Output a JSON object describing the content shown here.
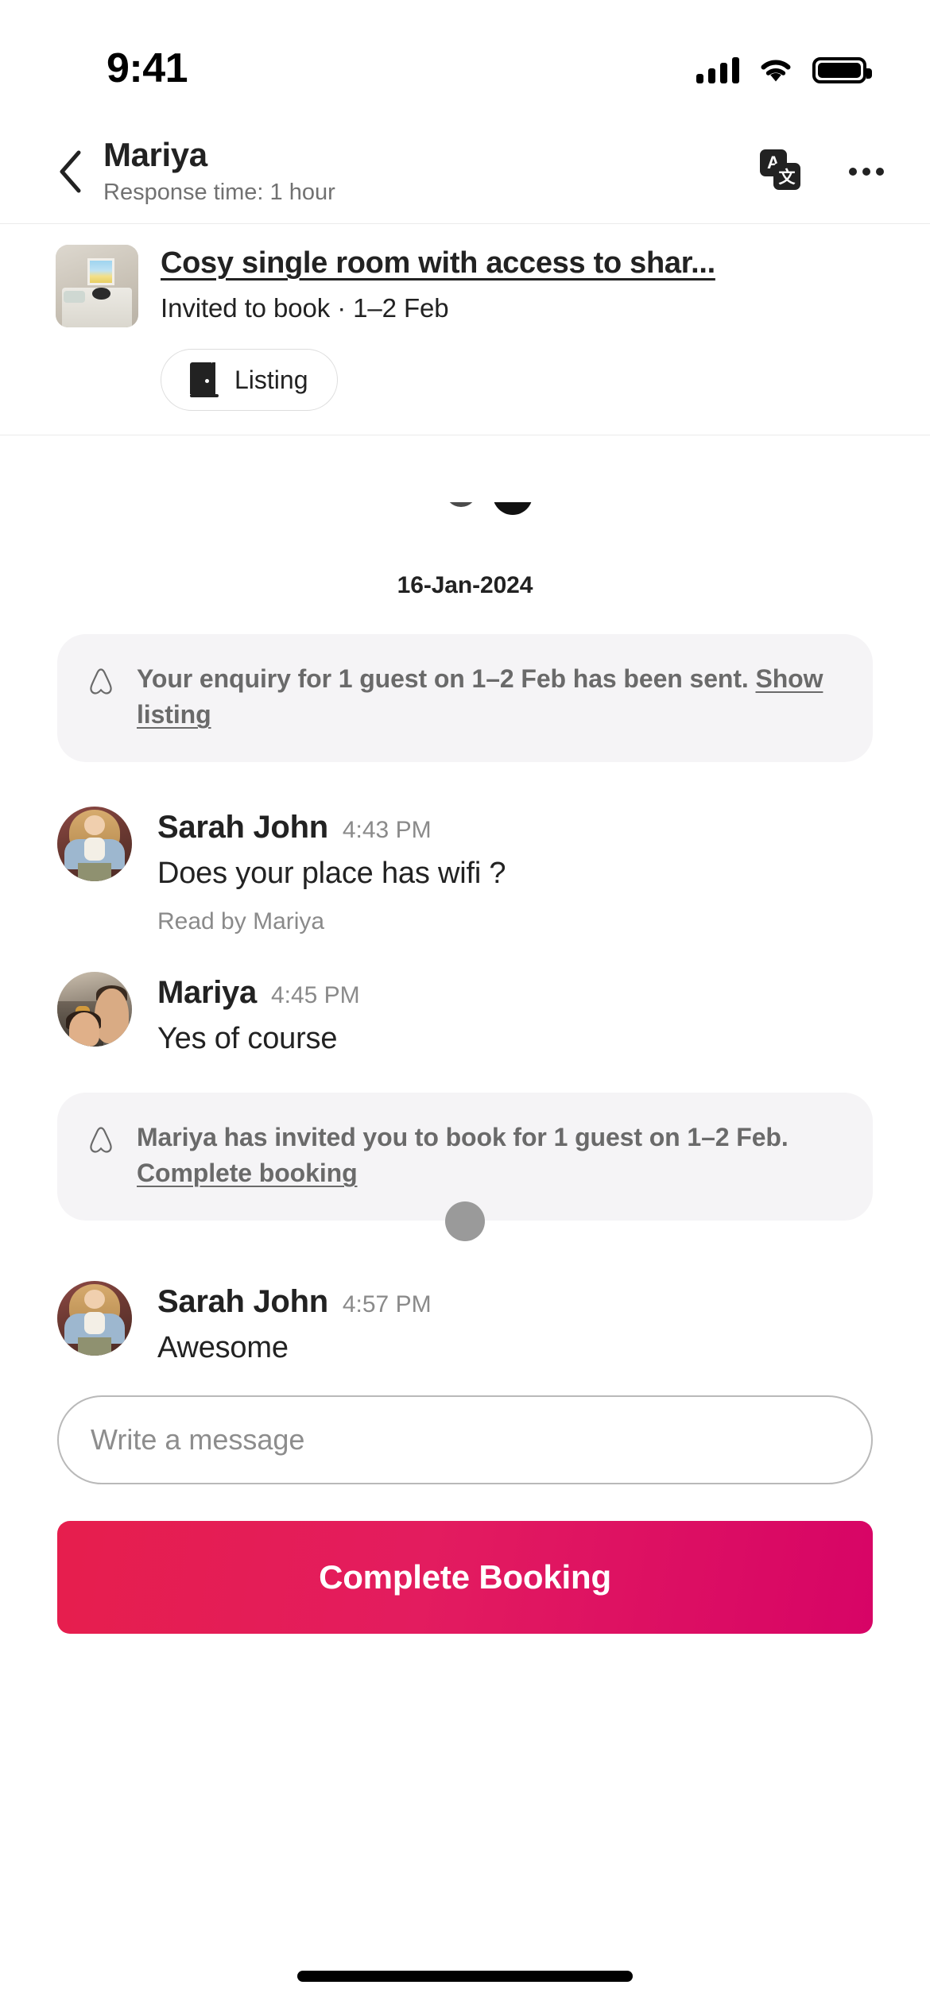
{
  "status_bar": {
    "time": "9:41",
    "signal_icon": "cellular-signal-icon",
    "wifi_icon": "wifi-icon",
    "battery_icon": "battery-full-icon"
  },
  "header": {
    "back_icon": "chevron-left-icon",
    "title": "Mariya",
    "subtitle": "Response time: 1 hour",
    "translate_icon": "translate-icon",
    "translate_glyph_primary": "A",
    "translate_glyph_secondary": "文",
    "more_icon": "more-horizontal-icon"
  },
  "listing_card": {
    "thumbnail_icon": "listing-photo-bedroom",
    "title": "Cosy single room with access to shar...",
    "meta": "Invited to book · 1–2 Feb",
    "pill": {
      "icon": "door-icon",
      "label": "Listing"
    }
  },
  "thread": {
    "date_separator": "16-Jan-2024",
    "items": [
      {
        "type": "system",
        "icon": "airbnb-belo-icon",
        "text": "Your enquiry for 1 guest on 1–2 Feb has been sent. ",
        "link": "Show listing",
        "has_dot": false
      },
      {
        "type": "message",
        "avatar": "avatar-sarah-john",
        "name": "Sarah John",
        "time": "4:43 PM",
        "text": "Does your place has wifi ?",
        "receipt": "Read by Mariya"
      },
      {
        "type": "message",
        "avatar": "avatar-mariya",
        "name": "Mariya",
        "time": "4:45 PM",
        "text": "Yes of course",
        "receipt": ""
      },
      {
        "type": "system",
        "icon": "airbnb-belo-icon",
        "text": "Mariya has invited you to book for 1 guest on 1–2 Feb. ",
        "link": "Complete booking",
        "has_dot": true
      },
      {
        "type": "message",
        "avatar": "avatar-sarah-john",
        "name": "Sarah John",
        "time": "4:57 PM",
        "text": "Awesome",
        "receipt": ""
      }
    ]
  },
  "composer": {
    "placeholder": "Write a message",
    "value": ""
  },
  "cta": {
    "label": "Complete Booking"
  },
  "home_indicator": "home-indicator",
  "colors": {
    "brand_pink_start": "#E61E4D",
    "brand_pink_mid": "#E31C5F",
    "brand_pink_end": "#D70466",
    "text_primary": "#222222",
    "text_secondary": "#717171",
    "text_muted": "#8A8A8A",
    "system_bubble_bg": "#F5F4F6",
    "divider": "#EBEBEB"
  }
}
